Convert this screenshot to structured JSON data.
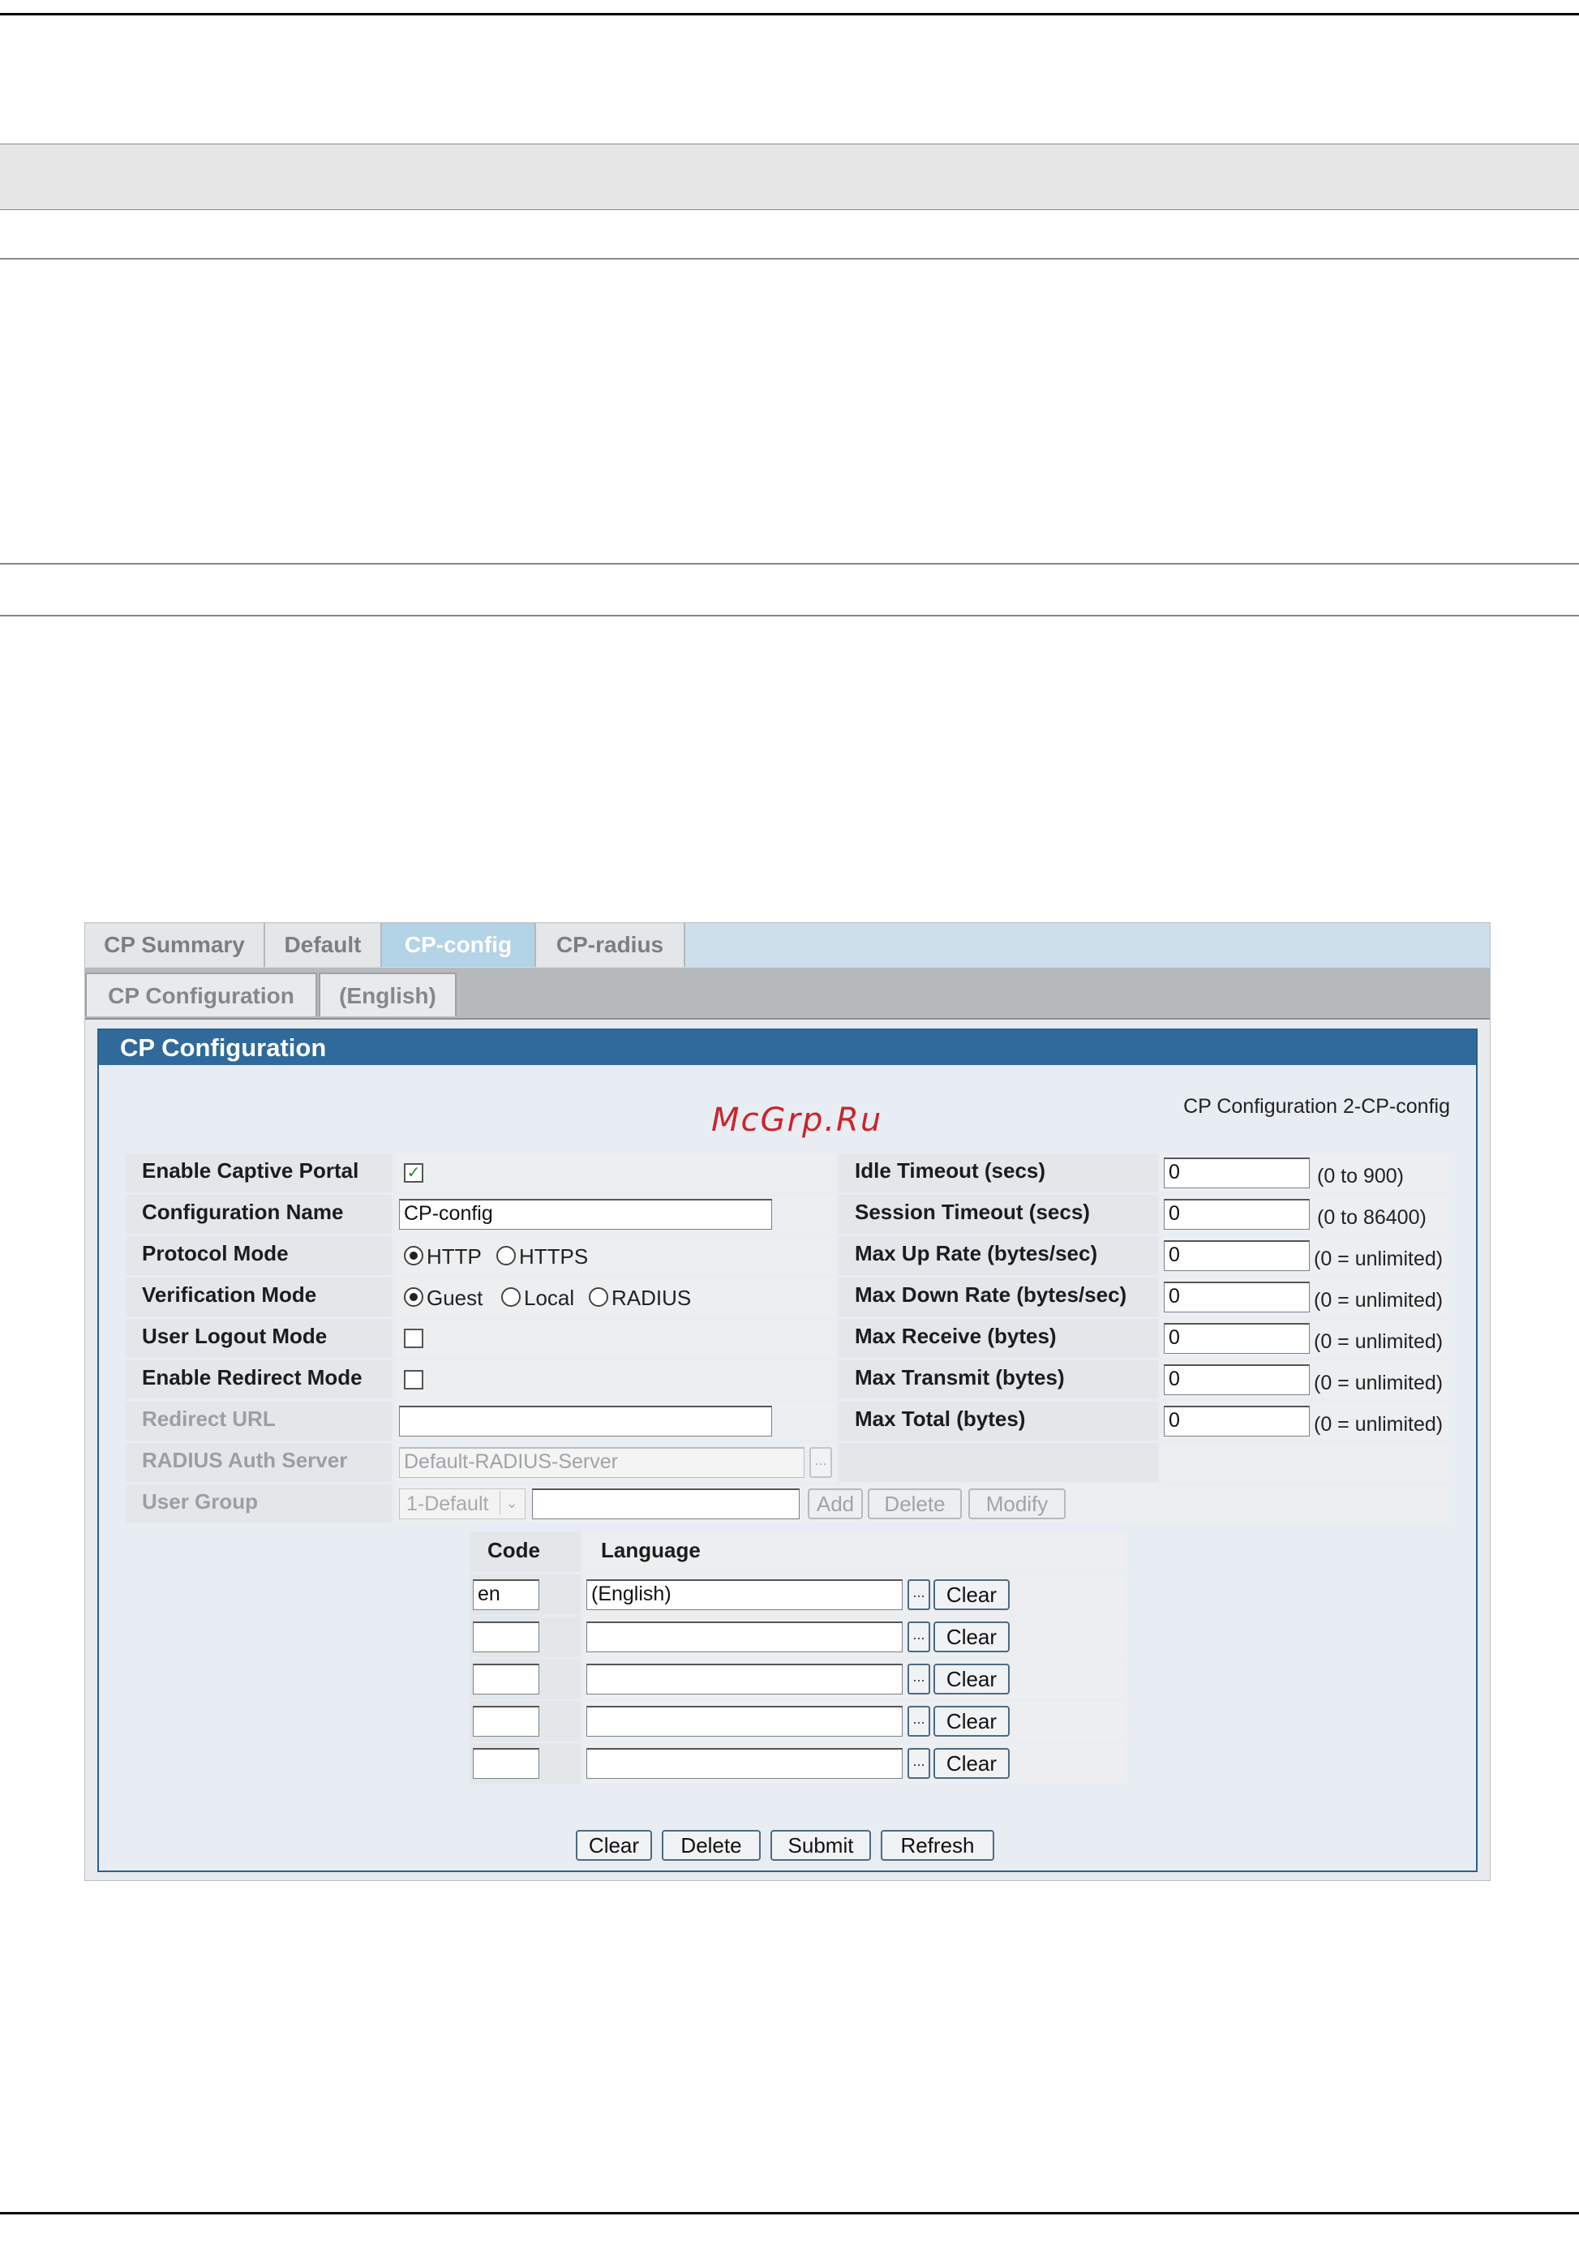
{
  "tabs": [
    "CP Summary",
    "Default",
    "CP-config",
    "CP-radius"
  ],
  "active_tab": "CP-config",
  "subtabs": [
    "CP Configuration",
    "(English)"
  ],
  "panel": {
    "title": "CP Configuration",
    "caption": "CP Configuration 2-CP-config"
  },
  "watermark": "McGrp.Ru",
  "left_fields": {
    "enable_captive_portal": {
      "label": "Enable Captive Portal",
      "checked": true
    },
    "configuration_name": {
      "label": "Configuration Name",
      "value": "CP-config"
    },
    "protocol_mode": {
      "label": "Protocol Mode",
      "options": [
        "HTTP",
        "HTTPS"
      ],
      "selected": "HTTP"
    },
    "verification_mode": {
      "label": "Verification Mode",
      "options": [
        "Guest",
        "Local",
        "RADIUS"
      ],
      "selected": "Guest"
    },
    "user_logout_mode": {
      "label": "User Logout Mode",
      "checked": false
    },
    "enable_redirect_mode": {
      "label": "Enable Redirect Mode",
      "checked": false
    },
    "redirect_url": {
      "label": "Redirect URL",
      "value": ""
    },
    "radius_auth_server": {
      "label": "RADIUS Auth Server",
      "value": "Default-RADIUS-Server"
    },
    "user_group": {
      "label": "User Group",
      "selected": "1-Default",
      "value": ""
    }
  },
  "right_fields": [
    {
      "label": "Idle Timeout (secs)",
      "value": "0",
      "hint": "(0 to 900)"
    },
    {
      "label": "Session Timeout (secs)",
      "value": "0",
      "hint": "(0 to 86400)"
    },
    {
      "label": "Max Up Rate (bytes/sec)",
      "value": "0",
      "hint": "(0 = unlimited)"
    },
    {
      "label": "Max Down Rate (bytes/sec)",
      "value": "0",
      "hint": "(0 = unlimited)"
    },
    {
      "label": "Max Receive (bytes)",
      "value": "0",
      "hint": "(0 = unlimited)"
    },
    {
      "label": "Max Transmit (bytes)",
      "value": "0",
      "hint": "(0 = unlimited)"
    },
    {
      "label": "Max Total (bytes)",
      "value": "0",
      "hint": "(0 = unlimited)"
    }
  ],
  "group_buttons": [
    "Add",
    "Delete",
    "Modify"
  ],
  "language_table": {
    "headers": [
      "Code",
      "Language"
    ],
    "rows": [
      {
        "code": "en",
        "language": "(English)"
      },
      {
        "code": "",
        "language": ""
      },
      {
        "code": "",
        "language": ""
      },
      {
        "code": "",
        "language": ""
      },
      {
        "code": "",
        "language": ""
      }
    ],
    "browse_label": "...",
    "clear_label": "Clear"
  },
  "actions": [
    "Clear",
    "Delete",
    "Submit",
    "Refresh"
  ],
  "colors": {
    "header_blue": "#2f6a9a",
    "tab_active": "#b3d3e6",
    "tabbar": "#ccdfea"
  }
}
